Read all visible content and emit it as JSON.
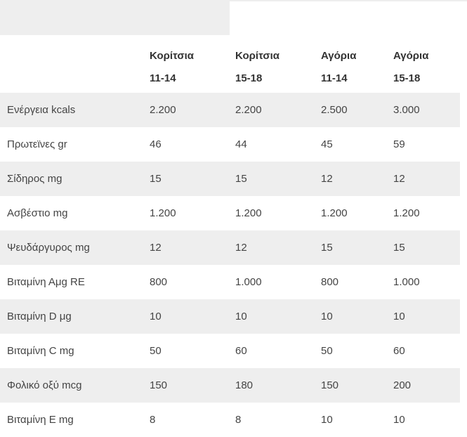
{
  "header": {
    "columns": [
      {
        "line1": "Κορίτσια",
        "line2": "11-14"
      },
      {
        "line1": "Κορίτσια",
        "line2": "15-18"
      },
      {
        "line1": "Αγόρια",
        "line2": "11-14"
      },
      {
        "line1": "Αγόρια",
        "line2": "15-18"
      }
    ]
  },
  "rows": [
    {
      "label": "Ενέργεια kcals",
      "values": [
        "2.200",
        "2.200",
        "2.500",
        "3.000"
      ]
    },
    {
      "label": "Πρωτεϊνες gr",
      "values": [
        "46",
        "44",
        "45",
        "59"
      ]
    },
    {
      "label": "Σίδηρος mg",
      "values": [
        "15",
        "15",
        "12",
        "12"
      ]
    },
    {
      "label": "Ασβέστιο mg",
      "values": [
        "1.200",
        "1.200",
        "1.200",
        "1.200"
      ]
    },
    {
      "label": "Ψευδάργυρος mg",
      "values": [
        "12",
        "12",
        "15",
        "15"
      ]
    },
    {
      "label": "Βιταμίνη Αμg RE",
      "values": [
        "800",
        "1.000",
        "800",
        "1.000"
      ]
    },
    {
      "label": "Βιταμίνη D μg",
      "values": [
        "10",
        "10",
        "10",
        "10"
      ]
    },
    {
      "label": "Βιταμίνη C mg",
      "values": [
        "50",
        "60",
        "50",
        "60"
      ]
    },
    {
      "label": "Φολικό οξύ mcg",
      "values": [
        "150",
        "180",
        "150",
        "200"
      ]
    },
    {
      "label": "Βιταμίνη Ε mg",
      "values": [
        "8",
        "8",
        "10",
        "10"
      ]
    }
  ]
}
